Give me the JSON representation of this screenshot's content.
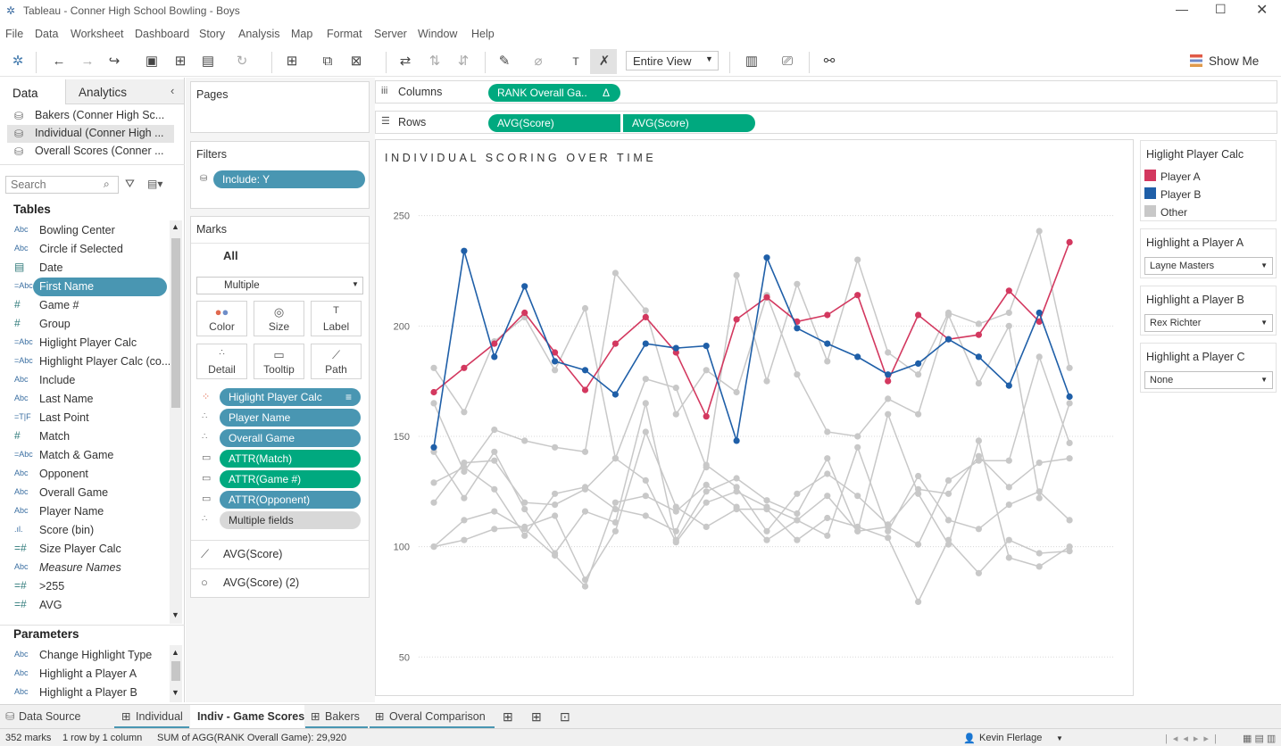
{
  "window": {
    "title": "Tableau - Conner High School Bowling - Boys"
  },
  "menu": [
    "File",
    "Data",
    "Worksheet",
    "Dashboard",
    "Story",
    "Analysis",
    "Map",
    "Format",
    "Server",
    "Window",
    "Help"
  ],
  "toolbar": {
    "fit": "Entire View",
    "show_me": "Show Me"
  },
  "left": {
    "tab_data": "Data",
    "tab_analytics": "Analytics",
    "sources": [
      "Bakers (Conner High Sc...",
      "Individual (Conner High ...",
      "Overall Scores (Conner ..."
    ],
    "search_placeholder": "Search",
    "tables_header": "Tables",
    "fields": [
      {
        "icon": "Abc",
        "name": "Bowling Center"
      },
      {
        "icon": "Abc",
        "name": "Circle if Selected"
      },
      {
        "icon": "▤",
        "name": "Date"
      },
      {
        "icon": "=Abc",
        "name": "First Name"
      },
      {
        "icon": "#",
        "name": "Game #"
      },
      {
        "icon": "#",
        "name": "Group"
      },
      {
        "icon": "=Abc",
        "name": "Higlight Player Calc"
      },
      {
        "icon": "=Abc",
        "name": "Highlight Player Calc (co..."
      },
      {
        "icon": "Abc",
        "name": "Include"
      },
      {
        "icon": "Abc",
        "name": "Last Name"
      },
      {
        "icon": "=T|F",
        "name": "Last Point"
      },
      {
        "icon": "#",
        "name": "Match"
      },
      {
        "icon": "=Abc",
        "name": "Match & Game"
      },
      {
        "icon": "Abc",
        "name": "Opponent"
      },
      {
        "icon": "Abc",
        "name": "Overall Game"
      },
      {
        "icon": "Abc",
        "name": "Player Name"
      },
      {
        "icon": ".ıl.",
        "name": "Score (bin)"
      },
      {
        "icon": "=#",
        "name": "Size Player Calc"
      },
      {
        "icon": "Abc",
        "name": "Measure Names"
      },
      {
        "icon": "=#",
        "name": ">255"
      },
      {
        "icon": "=#",
        "name": "AVG"
      }
    ],
    "params_header": "Parameters",
    "params": [
      {
        "icon": "Abc",
        "name": "Change Highlight Type"
      },
      {
        "icon": "Abc",
        "name": "Highlight a Player A"
      },
      {
        "icon": "Abc",
        "name": "Highlight a Player B"
      }
    ]
  },
  "shelves": {
    "pages": "Pages",
    "filters": "Filters",
    "filter_pill": "Include: Y",
    "columns_label": "Columns",
    "column_pill": "RANK Overall Ga..",
    "column_delta": "Δ",
    "rows_label": "Rows",
    "row_pills": [
      "AVG(Score)",
      "AVG(Score)"
    ]
  },
  "marks": {
    "title": "Marks",
    "all": "All",
    "type": "Multiple",
    "buttons": [
      "Color",
      "Size",
      "Label",
      "Detail",
      "Tooltip",
      "Path"
    ],
    "pills": [
      "Higlight Player Calc",
      "Player Name",
      "Overall Game",
      "ATTR(Match)",
      "ATTR(Game #)",
      "ATTR(Opponent)",
      "Multiple fields"
    ],
    "cards": [
      "AVG(Score)",
      "AVG(Score) (2)"
    ]
  },
  "legend": {
    "title": "Higlight Player Calc",
    "items": [
      {
        "label": "Player A",
        "color": "#d3385f"
      },
      {
        "label": "Player B",
        "color": "#1f5fa8"
      },
      {
        "label": "Other",
        "color": "#c8c8c8"
      }
    ]
  },
  "param_cards": [
    {
      "title": "Highlight a Player A",
      "value": "Layne Masters"
    },
    {
      "title": "Highlight a Player B",
      "value": "Rex Richter"
    },
    {
      "title": "Highlight a Player C",
      "value": "None"
    }
  ],
  "tabs": [
    "Data Source",
    "Individual",
    "Indiv - Game Scores",
    "Bakers",
    "Overal Comparison"
  ],
  "status": {
    "marks": "352 marks",
    "rows": "1 row by 1 column",
    "sum": "SUM of AGG(RANK Overall Game): 29,920",
    "user": "Kevin Flerlage"
  },
  "chart_data": {
    "type": "line",
    "title": "INDIVIDUAL SCORING OVER TIME",
    "ylim": [
      40,
      262
    ],
    "yticks": [
      50,
      100,
      150,
      200,
      250
    ],
    "grid": true,
    "x_count": 24,
    "series": [
      {
        "name": "Player A",
        "color": "#d3385f",
        "values": [
          170,
          181,
          192,
          206,
          188,
          171,
          192,
          204,
          188,
          159,
          203,
          213,
          202,
          205,
          214,
          175,
          205,
          194,
          196,
          216,
          202,
          238
        ]
      },
      {
        "name": "Player B",
        "color": "#1f5fa8",
        "values": [
          145,
          234,
          186,
          218,
          184,
          180,
          169,
          192,
          190,
          191,
          148,
          231,
          199,
          192,
          186,
          178,
          183,
          194,
          186,
          173,
          206,
          168
        ]
      },
      {
        "name": "Other",
        "color": "#c8c8c8",
        "values": [
          181,
          161,
          193,
          204,
          180,
          208,
          140,
          176,
          172,
          136,
          223,
          175,
          219,
          184,
          230,
          188,
          178,
          206,
          201,
          206,
          243,
          181
        ]
      },
      {
        "name": "Other",
        "color": "#c8c8c8",
        "values": [
          165,
          134,
          153,
          148,
          145,
          143,
          224,
          207,
          160,
          180,
          170,
          214,
          178,
          152,
          150,
          167,
          160,
          205,
          174,
          200,
          122,
          165
        ]
      },
      {
        "name": "Other",
        "color": "#c8c8c8",
        "values": [
          143,
          122,
          143,
          117,
          97,
          116,
          111,
          165,
          103,
          125,
          131,
          121,
          115,
          140,
          107,
          109,
          101,
          130,
          139,
          139,
          186,
          147
        ]
      },
      {
        "name": "Other",
        "color": "#c8c8c8",
        "values": [
          129,
          136,
          126,
          105,
          124,
          127,
          117,
          114,
          107,
          137,
          127,
          107,
          124,
          133,
          123,
          110,
          126,
          124,
          141,
          127,
          138,
          140
        ]
      },
      {
        "name": "Other",
        "color": "#c8c8c8",
        "values": [
          120,
          138,
          139,
          120,
          119,
          126,
          140,
          130,
          102,
          120,
          125,
          118,
          112,
          105,
          145,
          107,
          132,
          112,
          108,
          119,
          125,
          112
        ]
      },
      {
        "name": "Other",
        "color": "#c8c8c8",
        "values": [
          100,
          103,
          108,
          109,
          114,
          85,
          107,
          152,
          118,
          109,
          117,
          117,
          103,
          113,
          109,
          104,
          75,
          103,
          88,
          103,
          97,
          98
        ]
      },
      {
        "name": "Other",
        "color": "#c8c8c8",
        "values": [
          100,
          112,
          116,
          108,
          96,
          82,
          120,
          123,
          116,
          128,
          118,
          103,
          112,
          123,
          107,
          160,
          124,
          101,
          148,
          95,
          91,
          100
        ]
      }
    ]
  }
}
